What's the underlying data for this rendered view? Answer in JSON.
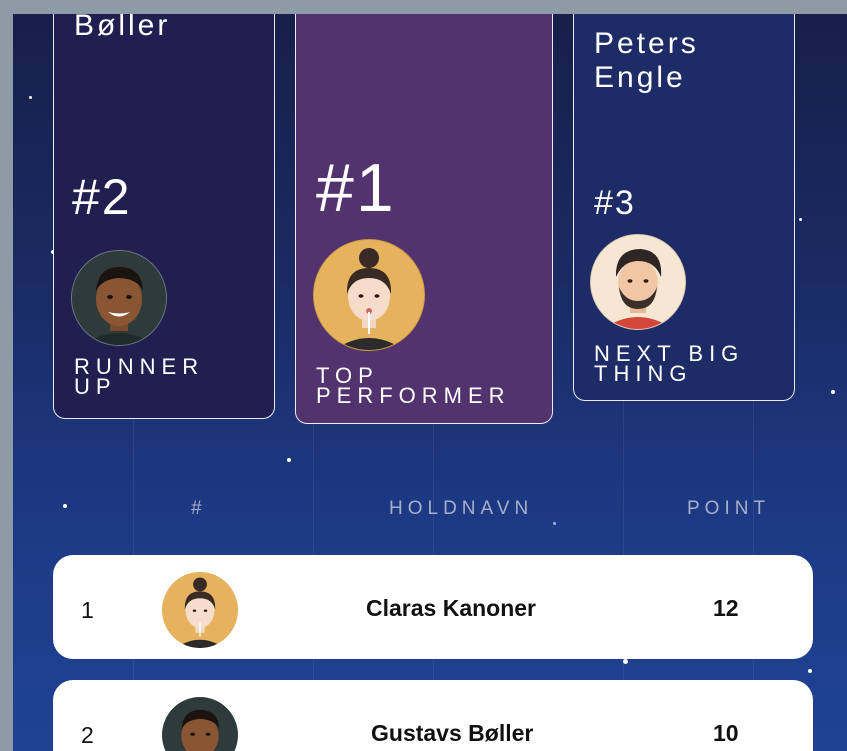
{
  "podium": {
    "second": {
      "name": "Bøller",
      "rank": "#2",
      "title": "RUNNER UP"
    },
    "first": {
      "rank": "#1",
      "title": "TOP PERFORMER"
    },
    "third": {
      "name": "Peters Engle",
      "rank": "#3",
      "title": "NEXT BIG THING"
    }
  },
  "table": {
    "headers": {
      "rank": "#",
      "team": "HOLDNAVN",
      "points": "POINT"
    },
    "rows": [
      {
        "rank": "1",
        "team": "Claras Kanoner",
        "points": "12",
        "avatar": "woman-avatar"
      },
      {
        "rank": "2",
        "team": "Gustavs Bøller",
        "points": "10",
        "avatar": "man-avatar"
      }
    ]
  },
  "colors": {
    "background_top": "#171f4a",
    "background_bottom": "#1f4392",
    "card_first": "#53336e",
    "card_second": "#211f4f",
    "card_third": "#1d2b66",
    "header_text": "#a5afc7"
  }
}
